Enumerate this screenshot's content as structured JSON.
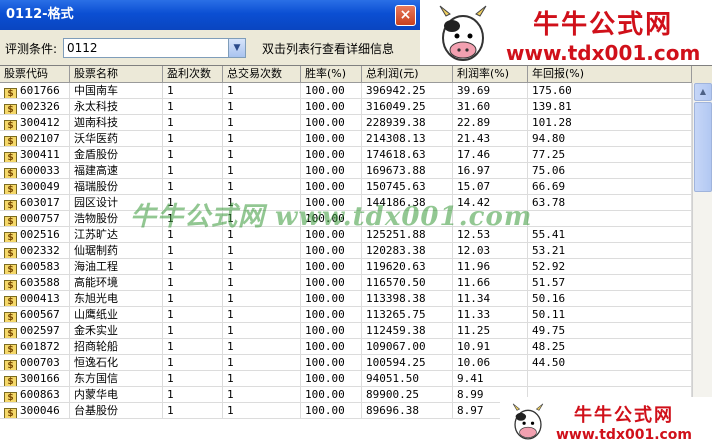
{
  "window": {
    "title": "0112-格式",
    "close_label": "×"
  },
  "logo": {
    "cn": "牛牛公式网",
    "url": "www.tdx001.com"
  },
  "filter": {
    "label": "评测条件:",
    "value": "0112",
    "hint": "双击列表行查看详细信息"
  },
  "watermark": "牛牛公式网 www.tdx001.com",
  "icons": {
    "code": "dollar-icon",
    "dropdown": "chevron-down-icon"
  },
  "columns": [
    "股票代码",
    "股票名称",
    "盈利次数",
    "总交易次数",
    "胜率(%)",
    "总利润(元)",
    "利润率(%)",
    "年回报(%)"
  ],
  "rows": [
    [
      "601766",
      "中国南车",
      "1",
      "1",
      "100.00",
      "396942.25",
      "39.69",
      "175.60"
    ],
    [
      "002326",
      "永太科技",
      "1",
      "1",
      "100.00",
      "316049.25",
      "31.60",
      "139.81"
    ],
    [
      "300412",
      "迦南科技",
      "1",
      "1",
      "100.00",
      "228939.38",
      "22.89",
      "101.28"
    ],
    [
      "002107",
      "沃华医药",
      "1",
      "1",
      "100.00",
      "214308.13",
      "21.43",
      "94.80"
    ],
    [
      "300411",
      "金盾股份",
      "1",
      "1",
      "100.00",
      "174618.63",
      "17.46",
      "77.25"
    ],
    [
      "600033",
      "福建高速",
      "1",
      "1",
      "100.00",
      "169673.88",
      "16.97",
      "75.06"
    ],
    [
      "300049",
      "福瑞股份",
      "1",
      "1",
      "100.00",
      "150745.63",
      "15.07",
      "66.69"
    ],
    [
      "603017",
      "园区设计",
      "1",
      "1",
      "100.00",
      "144186.38",
      "14.42",
      "63.78"
    ],
    [
      "000757",
      "浩物股份",
      "1",
      "1",
      "100.00",
      "",
      "",
      ""
    ],
    [
      "002516",
      "江苏旷达",
      "1",
      "1",
      "100.00",
      "125251.88",
      "12.53",
      "55.41"
    ],
    [
      "002332",
      "仙琚制药",
      "1",
      "1",
      "100.00",
      "120283.38",
      "12.03",
      "53.21"
    ],
    [
      "600583",
      "海油工程",
      "1",
      "1",
      "100.00",
      "119620.63",
      "11.96",
      "52.92"
    ],
    [
      "603588",
      "高能环境",
      "1",
      "1",
      "100.00",
      "116570.50",
      "11.66",
      "51.57"
    ],
    [
      "000413",
      "东旭光电",
      "1",
      "1",
      "100.00",
      "113398.38",
      "11.34",
      "50.16"
    ],
    [
      "600567",
      "山鹰纸业",
      "1",
      "1",
      "100.00",
      "113265.75",
      "11.33",
      "50.11"
    ],
    [
      "002597",
      "金禾实业",
      "1",
      "1",
      "100.00",
      "112459.38",
      "11.25",
      "49.75"
    ],
    [
      "601872",
      "招商轮船",
      "1",
      "1",
      "100.00",
      "109067.00",
      "10.91",
      "48.25"
    ],
    [
      "000703",
      "恒逸石化",
      "1",
      "1",
      "100.00",
      "100594.25",
      "10.06",
      "44.50"
    ],
    [
      "300166",
      "东方国信",
      "1",
      "1",
      "100.00",
      "94051.50",
      "9.41",
      ""
    ],
    [
      "600863",
      "内蒙华电",
      "1",
      "1",
      "100.00",
      "89900.25",
      "8.99",
      ""
    ],
    [
      "300046",
      "台基股份",
      "1",
      "1",
      "100.00",
      "89696.38",
      "8.97",
      ""
    ]
  ]
}
